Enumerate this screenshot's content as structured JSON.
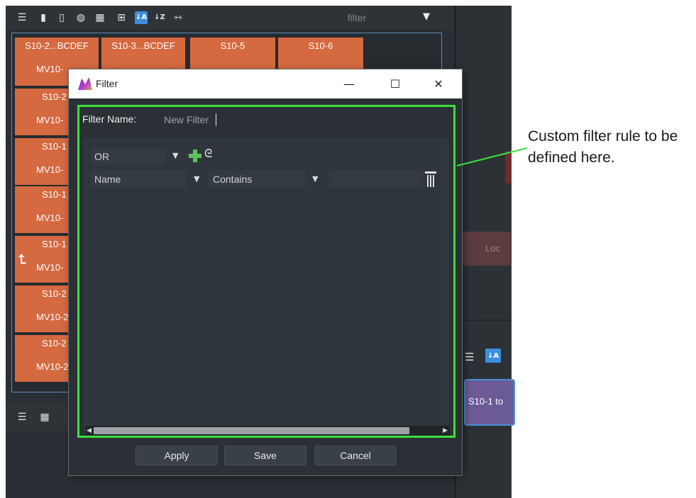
{
  "toolbar": {
    "filter_text": "filter",
    "icons": [
      "list-icon",
      "document-icon",
      "clipboard-icon",
      "paste-special-icon",
      "tile-large-icon",
      "tile-small-icon",
      "sort-az-icon",
      "sort-za-icon",
      "fit-width-icon",
      "funnel-icon"
    ]
  },
  "tiles": [
    {
      "line1": "S10-2...BCDEF",
      "line2": "MV10-"
    },
    {
      "line1": "S10-3...BCDEF",
      "line2": ""
    },
    {
      "line1": "S10-5",
      "line2": ""
    },
    {
      "line1": "S10-6",
      "line2": ""
    },
    {
      "line1": "S10-2",
      "line2": "MV10-"
    },
    {
      "line1": "S10-1",
      "line2": "MV10-"
    },
    {
      "line1": "S10-1",
      "line2": "MV10-"
    },
    {
      "line1": "S10-1",
      "line2": "MV10-"
    },
    {
      "line1": "S10-2",
      "line2": "MV10-2"
    },
    {
      "line1": "S10-2",
      "line2": "MV10-2"
    }
  ],
  "right_pane": {
    "lock_label": "Loc",
    "tile_label": "S10-1 to"
  },
  "dialog": {
    "title": "Filter",
    "filter_name_label": "Filter Name:",
    "filter_name_value": "New Filter",
    "logic_operator": "OR",
    "rule": {
      "field": "Name",
      "operator": "Contains",
      "value": ""
    },
    "buttons": {
      "apply": "Apply",
      "save": "Save",
      "cancel": "Cancel"
    },
    "window_controls": {
      "minimize": "—",
      "maximize": "☐",
      "close": "✕"
    }
  },
  "annotation": {
    "text": "Custom filter rule to be defined here.",
    "line_color": "#3be03b"
  },
  "colors": {
    "tile_orange": "#d5693f",
    "accent_blue": "#3d8fe0",
    "highlight_green": "#3be03b",
    "purple_tile": "#6a5b96"
  }
}
